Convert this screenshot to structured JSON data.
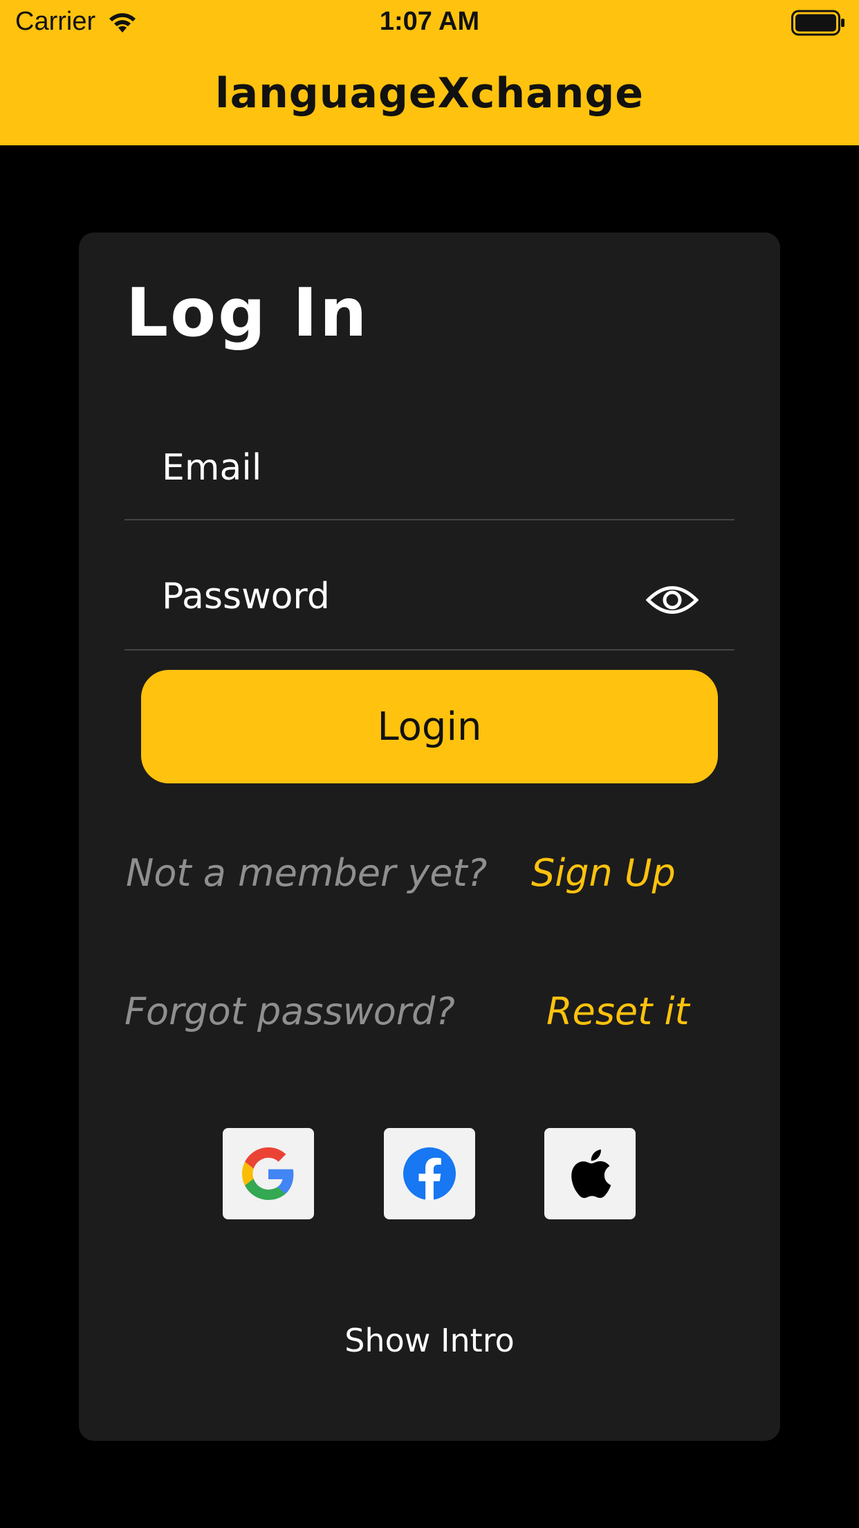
{
  "status_bar": {
    "carrier": "Carrier",
    "time": "1:07 AM"
  },
  "nav": {
    "title": "languageXchange"
  },
  "login_card": {
    "title": "Log In",
    "email_placeholder": "Email",
    "password_placeholder": "Password",
    "login_button": "Login",
    "signup_prompt": "Not a member yet?",
    "signup_link": "Sign Up",
    "forgot_prompt": "Forgot password?",
    "reset_link": "Reset it",
    "show_intro": "Show Intro"
  },
  "social_buttons": [
    {
      "icon": "google-icon"
    },
    {
      "icon": "facebook-icon"
    },
    {
      "icon": "apple-icon"
    }
  ],
  "colors": {
    "accent": "#FFC20E",
    "card": "#1C1C1C",
    "background": "#000000",
    "muted_text": "#8F8F8F"
  }
}
